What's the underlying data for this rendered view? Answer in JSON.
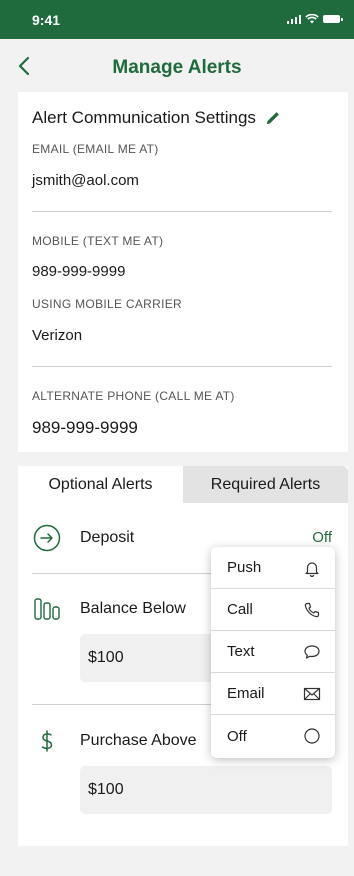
{
  "status_bar": {
    "time": "9:41"
  },
  "header": {
    "title": "Manage Alerts"
  },
  "settings": {
    "title": "Alert Communication Settings",
    "email_label": "EMAIL (EMAIL ME AT)",
    "email_value": "jsmith@aol.com",
    "mobile_label": "MOBILE (TEXT ME AT)",
    "mobile_value": "989-999-9999",
    "carrier_label": "USING MOBILE CARRIER",
    "carrier_value": "Verizon",
    "alt_phone_label": "ALTERNATE PHONE (CALL ME AT)",
    "alt_phone_value": "989-999-9999"
  },
  "tabs": [
    {
      "label": "Optional Alerts",
      "active": true
    },
    {
      "label": "Required Alerts",
      "active": false
    }
  ],
  "alerts": [
    {
      "label": "Deposit",
      "status": "Off",
      "icon": "arrow-circle-icon"
    },
    {
      "label": "Balance Below",
      "amount": "$100",
      "icon": "bars-icon"
    },
    {
      "label": "Purchase Above",
      "amount": "$100",
      "icon": "dollar-icon"
    }
  ],
  "dropdown": {
    "items": [
      {
        "label": "Push",
        "icon": "bell-icon"
      },
      {
        "label": "Call",
        "icon": "phone-icon"
      },
      {
        "label": "Text",
        "icon": "chat-icon"
      },
      {
        "label": "Email",
        "icon": "envelope-icon"
      },
      {
        "label": "Off",
        "icon": "circle-icon"
      }
    ]
  },
  "colors": {
    "brand_green": "#1f6b3e",
    "background": "#f2f2f2",
    "card": "#ffffff"
  }
}
